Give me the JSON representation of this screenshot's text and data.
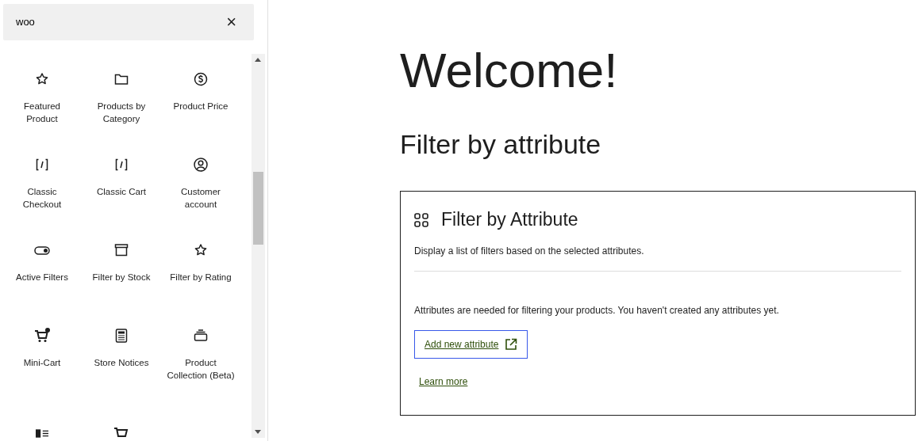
{
  "sidebar": {
    "search": {
      "value": "woo",
      "clear": "×"
    },
    "blocks": [
      {
        "kind": "star",
        "label": "Featured Product"
      },
      {
        "kind": "folder",
        "label": "Products by Category"
      },
      {
        "kind": "dollar",
        "label": "Product Price"
      },
      {
        "kind": "code",
        "label": "Classic Checkout"
      },
      {
        "kind": "code",
        "label": "Classic Cart"
      },
      {
        "kind": "user",
        "label": "Customer account"
      },
      {
        "kind": "toggle",
        "label": "Active Filters"
      },
      {
        "kind": "archive",
        "label": "Filter by Stock"
      },
      {
        "kind": "star",
        "label": "Filter by Rating"
      },
      {
        "kind": "cartdot",
        "label": "Mini-Cart"
      },
      {
        "kind": "calculator",
        "label": "Store Notices"
      },
      {
        "kind": "stack",
        "label": "Product Collection (Beta)"
      },
      {
        "kind": "sidebarlist"
      },
      {
        "kind": "cart"
      }
    ]
  },
  "main": {
    "title": "Welcome!",
    "heading": "Filter by attribute",
    "block": {
      "title": "Filter by Attribute",
      "description": "Display a list of filters based on the selected attributes.",
      "notice": "Attributes are needed for filtering your products. You haven't created any attributes yet.",
      "add_link": "Add new attribute",
      "learn_more": "Learn more"
    }
  }
}
